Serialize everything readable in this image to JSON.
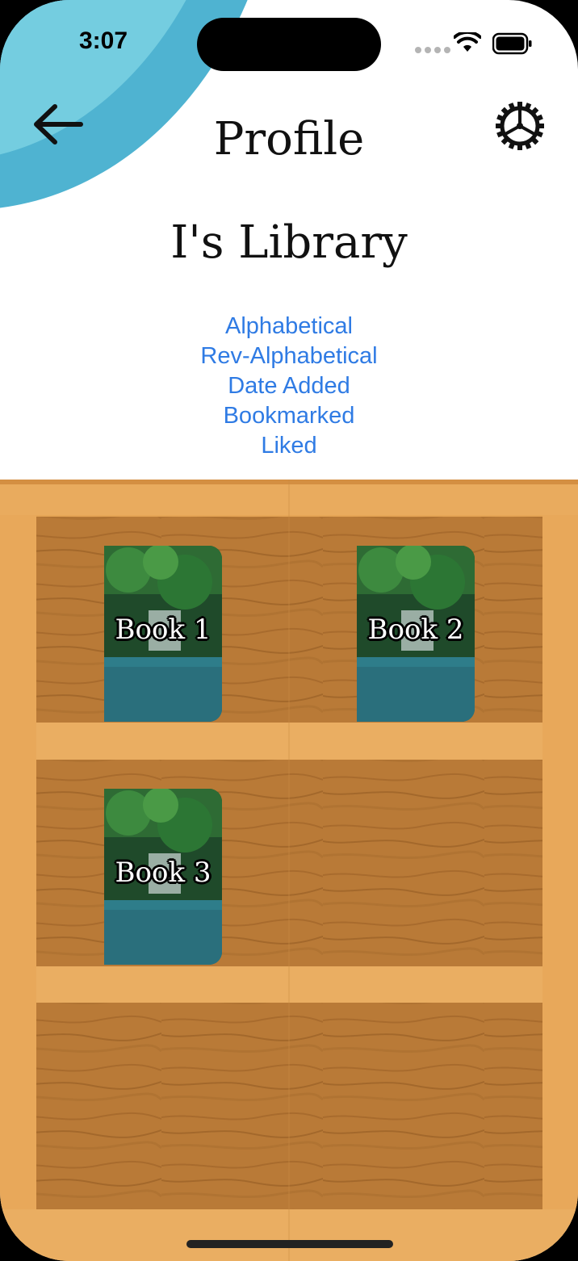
{
  "status": {
    "time": "3:07"
  },
  "header": {
    "title": "Profile",
    "library_title": "I's Library"
  },
  "sort_options": [
    "Alphabetical",
    "Rev-Alphabetical",
    "Date Added",
    "Bookmarked",
    "Liked"
  ],
  "books": [
    {
      "label": "Book 1"
    },
    {
      "label": "Book 2"
    },
    {
      "label": "Book 3"
    }
  ],
  "colors": {
    "accent": "#2f7be4",
    "blob": "#74cde0",
    "wood": "#b97a37",
    "wood_frame": "#e6a555"
  },
  "icons": {
    "back": "arrow-left-icon",
    "settings": "gear-icon"
  }
}
